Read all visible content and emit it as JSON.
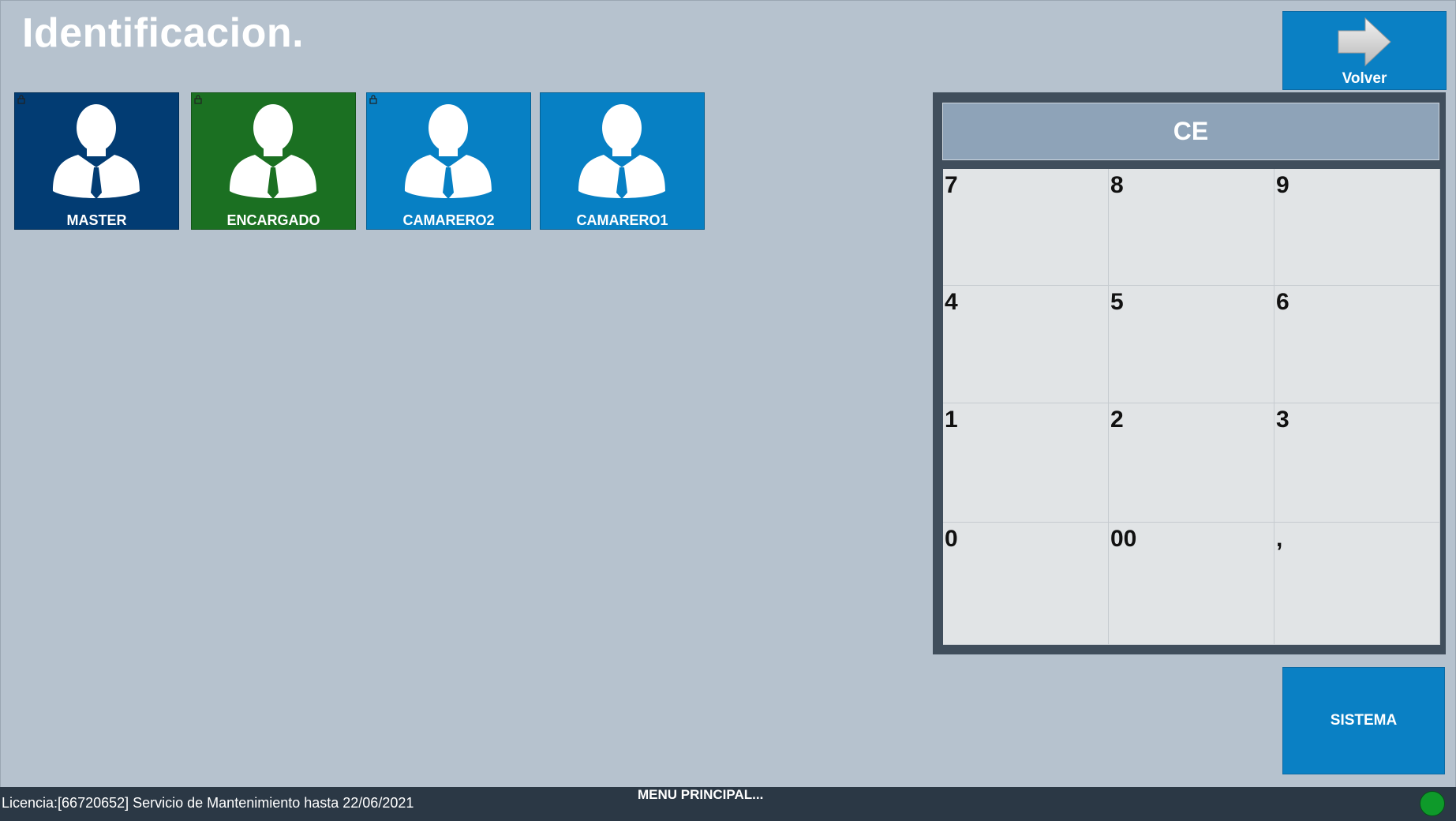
{
  "header": {
    "title": "Identificacion."
  },
  "volver_button": {
    "label": "Volver",
    "icon": "arrow-right-icon"
  },
  "users": [
    {
      "name": "MASTER",
      "color": "#023c73",
      "locked": true
    },
    {
      "name": "ENCARGADO",
      "color": "#1b7022",
      "locked": true
    },
    {
      "name": "CAMARERO2",
      "color": "#0780c4",
      "locked": true
    },
    {
      "name": "CAMARERO1",
      "color": "#0780c4",
      "locked": false
    }
  ],
  "keypad": {
    "clear_label": "CE",
    "keys": [
      "7",
      "8",
      "9",
      "4",
      "5",
      "6",
      "1",
      "2",
      "3",
      "0",
      "00",
      ","
    ]
  },
  "sistema_button": {
    "label": "SISTEMA"
  },
  "status_bar": {
    "license_text": "Licencia:[66720652] Servicio de Mantenimiento hasta 22/06/2021",
    "menu_text": "MENU PRINCIPAL...",
    "status_color": "#0e9a2a"
  }
}
